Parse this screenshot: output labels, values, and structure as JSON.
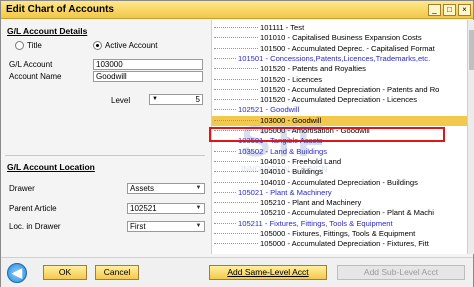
{
  "window": {
    "title": "Edit Chart of Accounts",
    "controls": [
      "_",
      "□",
      "×"
    ]
  },
  "gl_account_details": {
    "heading": "G/L Account Details",
    "radio_title": "Title",
    "radio_active": "Active Account",
    "selected": "Active Account",
    "gl_account_label": "G/L Account",
    "gl_account_value": "103000",
    "account_name_label": "Account Name",
    "account_name_value": "Goodwill",
    "level_label": "Level",
    "level_value": "5"
  },
  "gl_account_location": {
    "heading": "G/L Account Location",
    "drawer_label": "Drawer",
    "drawer_value": "Assets",
    "parent_label": "Parent Article",
    "parent_value": "102521",
    "loc_label": "Loc. in Drawer",
    "loc_value": "First"
  },
  "tree": [
    {
      "text": "101111 - Test",
      "type": "account"
    },
    {
      "text": "101010 - Capitalised Business Expansion Costs",
      "type": "account"
    },
    {
      "text": "101500 - Accumulated Deprec. - Capitalised Format",
      "type": "account"
    },
    {
      "text": "101501 - Concessions,Patents,Licences,Trademarks,etc.",
      "type": "title"
    },
    {
      "text": "101520 - Patents and Royalties",
      "type": "account"
    },
    {
      "text": "101520 - Licences",
      "type": "account"
    },
    {
      "text": "101520 - Accumulated Depreciation - Patents and Ro",
      "type": "account"
    },
    {
      "text": "101520 - Accumulated Depreciation - Licences",
      "type": "account"
    },
    {
      "text": "102521 - Goodwill",
      "type": "title"
    },
    {
      "text": "103000 - Goodwill",
      "type": "selected"
    },
    {
      "text": "105000 - Amortisation - Goodwill",
      "type": "account"
    },
    {
      "text": "103501 - Tangible Assets",
      "type": "title"
    },
    {
      "text": "103502 - Land & Buildings",
      "type": "title"
    },
    {
      "text": "104010 - Freehold Land",
      "type": "account"
    },
    {
      "text": "104010 - Buildings",
      "type": "account"
    },
    {
      "text": "104010 - Accumulated Depreciation - Buildings",
      "type": "account"
    },
    {
      "text": "105021 - Plant & Machinery",
      "type": "title"
    },
    {
      "text": "105210 - Plant and Machinery",
      "type": "account"
    },
    {
      "text": "105210 - Accumulated Depreciation - Plant & Machi",
      "type": "account"
    },
    {
      "text": "105211 - Fixtures, Fittings, Tools & Equipment",
      "type": "title"
    },
    {
      "text": "105000 - Fixtures, Fittings, Tools & Equipment",
      "type": "account"
    },
    {
      "text": "105000 - Accumulated Depreciation - Fixtures, Fitt",
      "type": "account"
    }
  ],
  "watermark": "STF INNOVATION · DESIGN",
  "footer": {
    "ok_label": "OK",
    "cancel_label": "Cancel",
    "add_same_level_label": "Add Same-Level Acct",
    "add_sub_level_label": "Add Sub-Level Acct"
  },
  "colors": {
    "title_bar": "#f2c64a",
    "selection": "#f2c94c",
    "title_account_text": "#2a2acc",
    "highlight_border": "#e01515"
  }
}
